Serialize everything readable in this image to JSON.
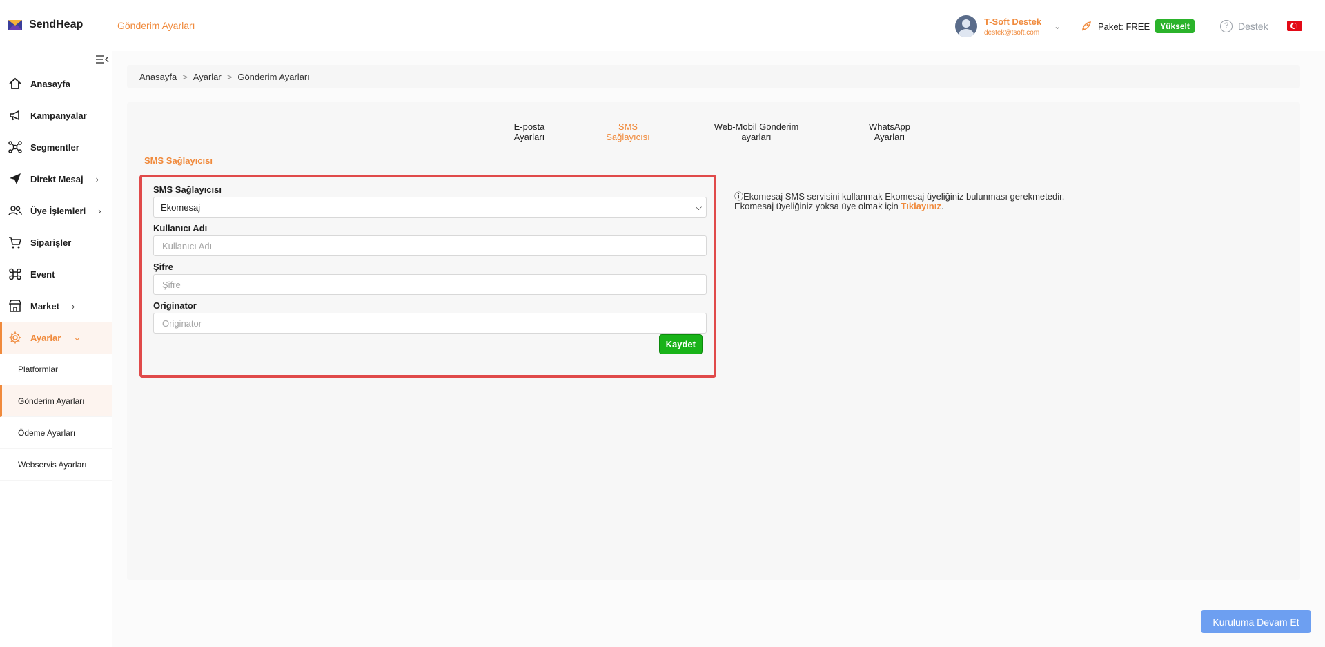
{
  "app": {
    "name": "SendHeap",
    "page_heading": "Gönderim Ayarları"
  },
  "user": {
    "name": "T-Soft Destek",
    "email": "destek@tsoft.com"
  },
  "plan": {
    "label": "Paket: FREE",
    "upgrade_label": "Yükselt"
  },
  "help": {
    "label": "Destek"
  },
  "sidebar": {
    "items": [
      {
        "label": "Anasayfa"
      },
      {
        "label": "Kampanyalar"
      },
      {
        "label": "Segmentler"
      },
      {
        "label": "Direkt Mesaj"
      },
      {
        "label": "Üye İşlemleri"
      },
      {
        "label": "Siparişler"
      },
      {
        "label": "Event"
      },
      {
        "label": "Market"
      },
      {
        "label": "Ayarlar"
      }
    ],
    "sub_items": [
      {
        "label": "Platformlar"
      },
      {
        "label": "Gönderim Ayarları"
      },
      {
        "label": "Ödeme Ayarları"
      },
      {
        "label": "Webservis Ayarları"
      }
    ]
  },
  "breadcrumb": {
    "items": [
      "Anasayfa",
      "Ayarlar",
      "Gönderim Ayarları"
    ],
    "separator": ">"
  },
  "tabs": [
    {
      "line1": "E-posta",
      "line2": "Ayarları"
    },
    {
      "line1": "SMS",
      "line2": "Sağlayıcısı"
    },
    {
      "line1": "Web-Mobil Gönderim",
      "line2": "ayarları"
    },
    {
      "line1": "WhatsApp",
      "line2": "Ayarları"
    }
  ],
  "section_title": "SMS Sağlayıcısı",
  "form": {
    "provider_label": "SMS Sağlayıcısı",
    "provider_value": "Ekomesaj",
    "username_label": "Kullanıcı Adı",
    "username_placeholder": "Kullanıcı Adı",
    "password_label": "Şifre",
    "password_placeholder": "Şifre",
    "originator_label": "Originator",
    "originator_placeholder": "Originator",
    "save_label": "Kaydet"
  },
  "info": {
    "line1": "Ekomesaj SMS servisini kullanmak Ekomesaj üyeliğiniz bulunması gerekmetedir.",
    "line2_prefix": "Ekomesaj üyeliğiniz yoksa üye olmak için",
    "link": "Tıklayınız",
    "line2_suffix": "."
  },
  "continue_label": "Kuruluma Devam Et",
  "colors": {
    "accent": "#f08a3c",
    "green": "#19b319",
    "highlight": "#e04a4a",
    "primary_blue": "#6d9ff1"
  }
}
